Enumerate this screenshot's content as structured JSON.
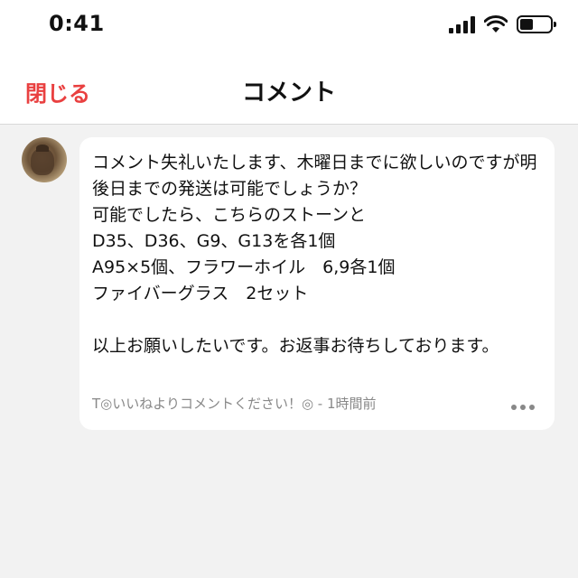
{
  "status_bar": {
    "time": "0:41"
  },
  "navbar": {
    "close_label": "閉じる",
    "title": "コメント",
    "close_color": "#e94040"
  },
  "comment": {
    "body": "コメント失礼いたします、木曜日までに欲しいのですが明後日までの発送は可能でしょうか？\n可能でしたら、こちらのストーンと\nD35、D36、G9、G13を各1個\nA95×5個、フラワーホイル　6,9各1個\nファイバーグラス　2セット\n\n以上お願いしたいです。お返事お待ちしております。",
    "meta": "T◎いいねよりコメントください！◎ - 1時間前"
  }
}
